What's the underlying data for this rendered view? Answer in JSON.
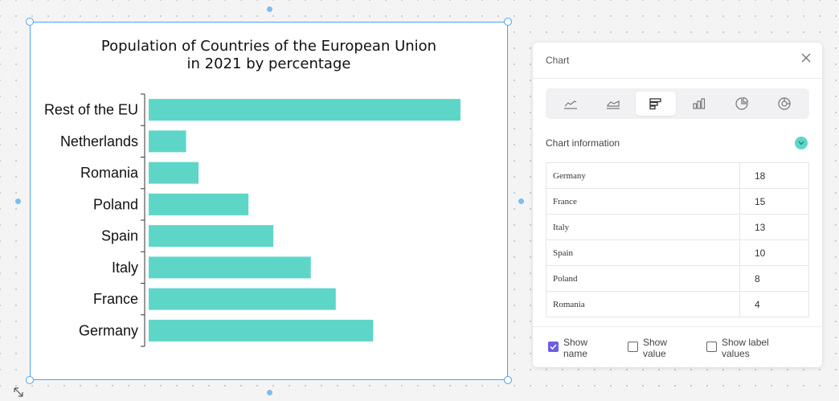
{
  "canvas": {
    "accent_color": "#4aa3f0"
  },
  "chart_data": {
    "type": "bar",
    "orientation": "horizontal",
    "title": "Population of Countries of the European Union in 2021 by percentage",
    "title_lines": [
      "Population of Countries of the European Union",
      "in 2021 by percentage"
    ],
    "categories": [
      "Rest of the EU",
      "Netherlands",
      "Romania",
      "Poland",
      "Spain",
      "Italy",
      "France",
      "Germany"
    ],
    "values": [
      25,
      3,
      4,
      8,
      10,
      13,
      15,
      18
    ],
    "bar_color": "#5dd6c8",
    "xlim": [
      0,
      25
    ],
    "grid": false,
    "legend": "none",
    "xlabel": "",
    "ylabel": ""
  },
  "panel": {
    "title": "Chart",
    "close_icon": "close-icon",
    "chart_types": [
      {
        "icon": "line-chart-icon",
        "active": false
      },
      {
        "icon": "area-chart-icon",
        "active": false
      },
      {
        "icon": "horizontal-bar-chart-icon",
        "active": true
      },
      {
        "icon": "column-chart-icon",
        "active": false
      },
      {
        "icon": "pie-chart-icon",
        "active": false
      },
      {
        "icon": "donut-chart-icon",
        "active": false
      }
    ],
    "section_label": "Chart information",
    "collapse_icon": "chevron-down-icon",
    "rows": [
      {
        "name": "Germany",
        "value": "18"
      },
      {
        "name": "France",
        "value": "15"
      },
      {
        "name": "Italy",
        "value": "13"
      },
      {
        "name": "Spain",
        "value": "10"
      },
      {
        "name": "Poland",
        "value": "8"
      },
      {
        "name": "Romania",
        "value": "4"
      }
    ],
    "options": [
      {
        "label_line1": "Show",
        "label_line2": "name",
        "checked": true
      },
      {
        "label_line1": "Show",
        "label_line2": "value",
        "checked": false
      },
      {
        "label_line1": "Show label",
        "label_line2": "values",
        "checked": false
      }
    ],
    "check_color": "#6c5ce7"
  }
}
